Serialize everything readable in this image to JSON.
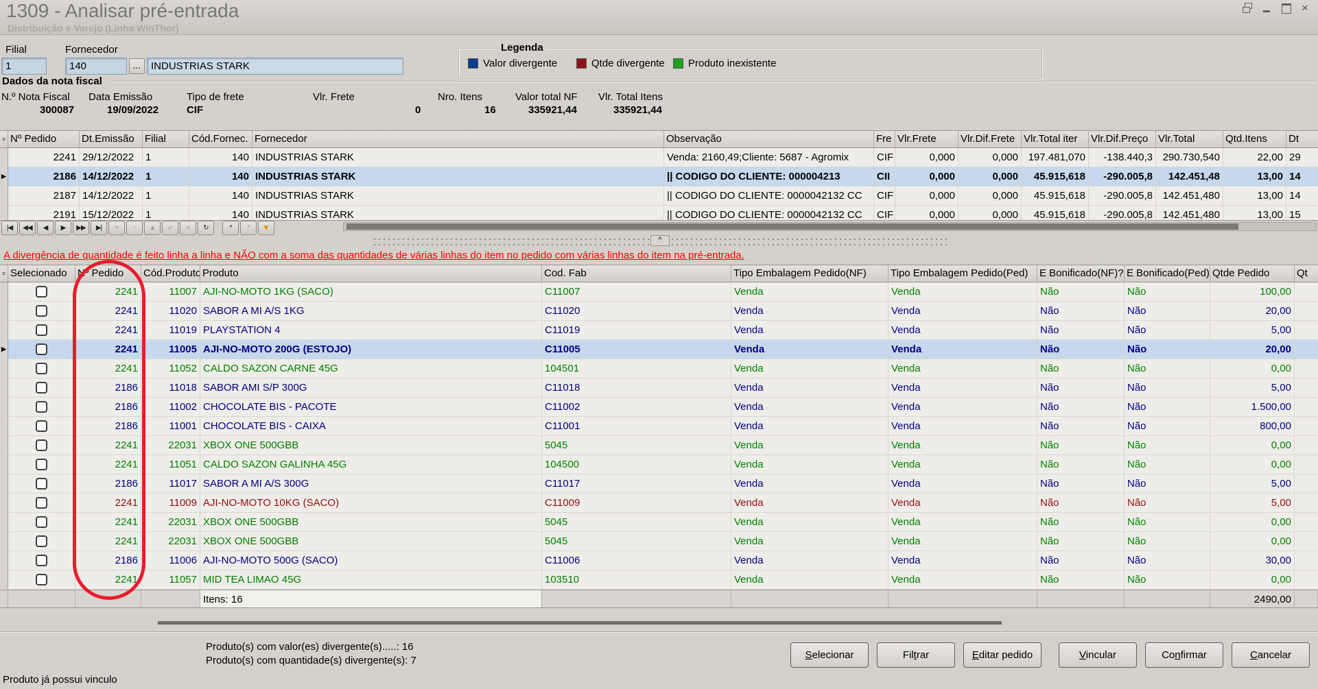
{
  "window": {
    "title": "1309 - Analisar pré-entrada",
    "subtitle": "Distribuição e Varejo (Linha WinThor)"
  },
  "filters": {
    "filial_label": "Filial",
    "filial_value": "1",
    "fornecedor_label": "Fornecedor",
    "fornecedor_code": "140",
    "browse_label": "...",
    "fornecedor_name": "INDUSTRIAS STARK"
  },
  "legend": {
    "title": "Legenda",
    "items": [
      {
        "label": "Valor divergente",
        "color": "#123a8f"
      },
      {
        "label": "Qtde divergente",
        "color": "#8c1419"
      },
      {
        "label": "Produto inexistente",
        "color": "#1fa01f"
      }
    ]
  },
  "nota_fiscal": {
    "title": "Dados da nota fiscal",
    "fields": [
      {
        "label": "N.º Nota Fiscal",
        "value": "300087"
      },
      {
        "label": "Data Emissão",
        "value": "19/09/2022"
      },
      {
        "label": "Tipo de frete",
        "value": "CIF"
      },
      {
        "label": "Vlr. Frete",
        "value": "0"
      },
      {
        "label": "Nro. Itens",
        "value": "16"
      },
      {
        "label": "Valor total NF",
        "value": "335921,44"
      },
      {
        "label": "Vlr. Total Itens",
        "value": "335921,44"
      }
    ]
  },
  "orders_grid": {
    "columns": [
      "Nº Pedido",
      "Dt.Emissão",
      "Filial",
      "Cód.Fornec.",
      "Fornecedor",
      "Observação",
      "Fre",
      "Vlr.Frete",
      "Vlr.Dif.Frete",
      "Vlr.Total iter",
      "Vlr.Dif.Preço",
      "Vlr.Total",
      "Qtd.Itens",
      "Dt"
    ],
    "rows": [
      {
        "selected": false,
        "cells": [
          "2241",
          "29/12/2022",
          "1",
          "140",
          "INDUSTRIAS STARK",
          "Venda: 2160,49;Cliente: 5687 - Agromix",
          "CIF",
          "0,000",
          "0,000",
          "197.481,070",
          "-138.440,3",
          "290.730,540",
          "22,00",
          "29"
        ]
      },
      {
        "selected": true,
        "cells": [
          "2186",
          "14/12/2022",
          "1",
          "140",
          "INDUSTRIAS STARK",
          "|| CODIGO DO CLIENTE: 000004213",
          "CII",
          "0,000",
          "0,000",
          "45.915,618",
          "-290.005,8",
          "142.451,48",
          "13,00",
          "14"
        ]
      },
      {
        "selected": false,
        "cells": [
          "2187",
          "14/12/2022",
          "1",
          "140",
          "INDUSTRIAS STARK",
          "|| CODIGO DO CLIENTE: 0000042132 CC",
          "CIF",
          "0,000",
          "0,000",
          "45.915,618",
          "-290.005,8",
          "142.451,480",
          "13,00",
          "14"
        ]
      },
      {
        "selected": false,
        "cells": [
          "2191",
          "15/12/2022",
          "1",
          "140",
          "INDUSTRIAS STARK",
          "|| CODIGO DO CLIENTE: 0000042132 CC",
          "CIF",
          "0,000",
          "0,000",
          "45.915,618",
          "-290.005,8",
          "142.451,480",
          "13,00",
          "15"
        ]
      }
    ]
  },
  "navigator": {
    "buttons": [
      {
        "name": "first-icon",
        "enabled": true
      },
      {
        "name": "prior-page-icon",
        "enabled": true
      },
      {
        "name": "prior-icon",
        "enabled": true
      },
      {
        "name": "next-icon",
        "enabled": true
      },
      {
        "name": "next-page-icon",
        "enabled": true
      },
      {
        "name": "last-icon",
        "enabled": true
      },
      {
        "name": "insert-icon",
        "enabled": false
      },
      {
        "name": "delete-icon",
        "enabled": false
      },
      {
        "name": "edit-icon",
        "enabled": false
      },
      {
        "name": "post-icon",
        "enabled": false
      },
      {
        "name": "cancel-icon",
        "enabled": false
      },
      {
        "name": "refresh-icon",
        "enabled": true
      },
      {
        "name": "bookmark-icon",
        "enabled": true
      },
      {
        "name": "goto-bookmark-icon",
        "enabled": false
      },
      {
        "name": "filter-icon",
        "enabled": true
      }
    ]
  },
  "splitter": {
    "collapse_label": "^"
  },
  "warning": "A divergência de quantidade é feito linha a linha e NÃO com a soma das quantidades de várias linhas do item no pedido com várias linhas do item na pré-entrada.",
  "products_grid": {
    "columns": [
      "Selecionado",
      "Nº Pedido",
      "Cód.Produto",
      "Produto",
      "Cod. Fab",
      "Tipo Embalagem Pedido(NF)",
      "Tipo Embalagem Pedido(Ped)",
      "E Bonificado(NF)?",
      "E Bonificado(Ped)?",
      "Qtde Pedido",
      "Qt"
    ],
    "rows": [
      {
        "selected": false,
        "color": "green",
        "checked": false,
        "cells": [
          "2241",
          "11007",
          "AJI-NO-MOTO 1KG (SACO)",
          "C11007",
          "Venda",
          "Venda",
          "Não",
          "Não",
          "100,00",
          ""
        ]
      },
      {
        "selected": false,
        "color": "navy",
        "checked": false,
        "cells": [
          "2241",
          "11020",
          "SABOR A MI A/S 1KG",
          "C11020",
          "Venda",
          "Venda",
          "Não",
          "Não",
          "20,00",
          ""
        ]
      },
      {
        "selected": false,
        "color": "navy",
        "checked": false,
        "cells": [
          "2241",
          "11019",
          "PLAYSTATION 4",
          "C11019",
          "Venda",
          "Venda",
          "Não",
          "Não",
          "5,00",
          ""
        ]
      },
      {
        "selected": true,
        "color": "navy",
        "checked": false,
        "cells": [
          "2241",
          "11005",
          "AJI-NO-MOTO 200G (ESTOJO)",
          "C11005",
          "Venda",
          "Venda",
          "Não",
          "Não",
          "20,00",
          ""
        ]
      },
      {
        "selected": false,
        "color": "green",
        "checked": false,
        "cells": [
          "2241",
          "11052",
          "CALDO SAZON CARNE 45G",
          "104501",
          "Venda",
          "Venda",
          "Não",
          "Não",
          "0,00",
          ""
        ]
      },
      {
        "selected": false,
        "color": "navy",
        "checked": false,
        "cells": [
          "2186",
          "11018",
          "SABOR AMI S/P 300G",
          "C11018",
          "Venda",
          "Venda",
          "Não",
          "Não",
          "5,00",
          ""
        ]
      },
      {
        "selected": false,
        "color": "navy",
        "checked": false,
        "cells": [
          "2186",
          "11002",
          "CHOCOLATE BIS - PACOTE",
          "C11002",
          "Venda",
          "Venda",
          "Não",
          "Não",
          "1.500,00",
          ""
        ]
      },
      {
        "selected": false,
        "color": "navy",
        "checked": false,
        "cells": [
          "2186",
          "11001",
          "CHOCOLATE BIS - CAIXA",
          "C11001",
          "Venda",
          "Venda",
          "Não",
          "Não",
          "800,00",
          ""
        ]
      },
      {
        "selected": false,
        "color": "green",
        "checked": false,
        "cells": [
          "2241",
          "22031",
          "XBOX ONE 500GBB",
          "5045",
          "Venda",
          "Venda",
          "Não",
          "Não",
          "0,00",
          ""
        ]
      },
      {
        "selected": false,
        "color": "green",
        "checked": false,
        "cells": [
          "2241",
          "11051",
          "CALDO SAZON GALINHA 45G",
          "104500",
          "Venda",
          "Venda",
          "Não",
          "Não",
          "0,00",
          ""
        ]
      },
      {
        "selected": false,
        "color": "navy",
        "checked": false,
        "cells": [
          "2186",
          "11017",
          "SABOR A MI A/S 300G",
          "C11017",
          "Venda",
          "Venda",
          "Não",
          "Não",
          "5,00",
          ""
        ]
      },
      {
        "selected": false,
        "color": "maroon",
        "checked": false,
        "cells": [
          "2241",
          "11009",
          "AJI-NO-MOTO 10KG (SACO)",
          "C11009",
          "Venda",
          "Venda",
          "Não",
          "Não",
          "5,00",
          ""
        ]
      },
      {
        "selected": false,
        "color": "green",
        "checked": false,
        "cells": [
          "2241",
          "22031",
          "XBOX ONE 500GBB",
          "5045",
          "Venda",
          "Venda",
          "Não",
          "Não",
          "0,00",
          ""
        ]
      },
      {
        "selected": false,
        "color": "green",
        "checked": false,
        "cells": [
          "2241",
          "22031",
          "XBOX ONE 500GBB",
          "5045",
          "Venda",
          "Venda",
          "Não",
          "Não",
          "0,00",
          ""
        ]
      },
      {
        "selected": false,
        "color": "navy",
        "checked": false,
        "cells": [
          "2186",
          "11006",
          "AJI-NO-MOTO 500G (SACO)",
          "C11006",
          "Venda",
          "Venda",
          "Não",
          "Não",
          "30,00",
          ""
        ]
      },
      {
        "selected": false,
        "color": "green",
        "checked": false,
        "cells": [
          "2241",
          "11057",
          "MID TEA LIMAO 45G",
          "103510",
          "Venda",
          "Venda",
          "Não",
          "Não",
          "0,00",
          ""
        ]
      }
    ],
    "footer": {
      "itens_label": "Itens: 16",
      "total": "2490,00"
    }
  },
  "summary": {
    "line1": "Produto(s) com valor(es) divergente(s).....: 16",
    "line2": "Produto(s) com quantidade(s) divergente(s): 7"
  },
  "actions": [
    {
      "label": "Selecionar",
      "accel": 0
    },
    {
      "label": "Filtrar",
      "accel": 3
    },
    {
      "label": "Editar pedido",
      "accel": 0
    },
    {
      "label": "Vincular",
      "accel": 0
    },
    {
      "label": "Confirmar",
      "accel": 2
    },
    {
      "label": "Cancelar",
      "accel": 0
    }
  ],
  "status_bar": "Produto já possui vinculo",
  "annotation": {
    "color": "#ea1c2d"
  }
}
